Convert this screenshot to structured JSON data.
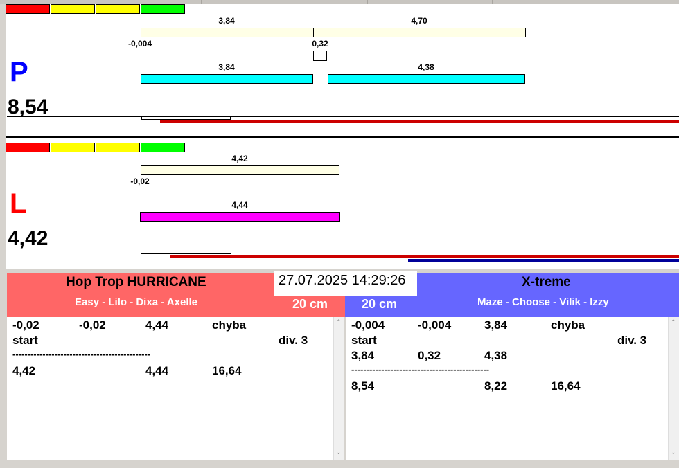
{
  "lanes": {
    "p": {
      "letter": "P",
      "letter_color": "#0000ff",
      "total": "8,54",
      "lights": [
        "#ff0000",
        "#ffff00",
        "#ffff00",
        "#00ff00"
      ],
      "ref_labels": [
        "3,84",
        "4,70"
      ],
      "start_label": "-0,004",
      "gap_label": "0,32",
      "run_labels": [
        "3,84",
        "4,38"
      ],
      "run_color": "#00ffff",
      "ref_color": "#ffffe6",
      "timeline_color": "#cc0000"
    },
    "l": {
      "letter": "L",
      "letter_color": "#ff0000",
      "total": "4,42",
      "lights": [
        "#ff0000",
        "#ffff00",
        "#ffff00",
        "#00ff00"
      ],
      "ref_labels": [
        "4,42"
      ],
      "start_label": "-0,02",
      "run_labels": [
        "4,44"
      ],
      "run_color": "#ff00ff",
      "ref_color": "#ffffe6",
      "timeline_color": "#cc0000",
      "timeline2_color": "#000099"
    }
  },
  "datetime": "27.07.2025 14:29:26",
  "teams": {
    "left": {
      "name": "Hop Trop HURRICANE",
      "members": "Easy - Lilo - Dixa - Axelle",
      "height": "20 cm",
      "bg": "#ff6666",
      "log": [
        [
          "-0,02",
          "-0,02",
          "4,44",
          "chyba"
        ],
        [
          "start",
          "",
          "",
          "",
          "div.  3"
        ],
        [
          "----------------------------------------------"
        ],
        [
          "4,42",
          "",
          "4,44",
          "16,64"
        ]
      ]
    },
    "right": {
      "name": "X-treme",
      "members": "Maze - Choose - Vilik - Izzy",
      "height": "20 cm",
      "bg": "#6666ff",
      "log": [
        [
          "-0,004",
          "-0,004",
          "3,84",
          "chyba"
        ],
        [
          "start",
          "",
          "",
          "",
          "div.  3"
        ],
        [
          "3,84",
          "0,32",
          "4,38"
        ],
        [
          "----------------------------------------------"
        ],
        [
          "8,54",
          "",
          "8,22",
          "16,64"
        ]
      ]
    }
  }
}
